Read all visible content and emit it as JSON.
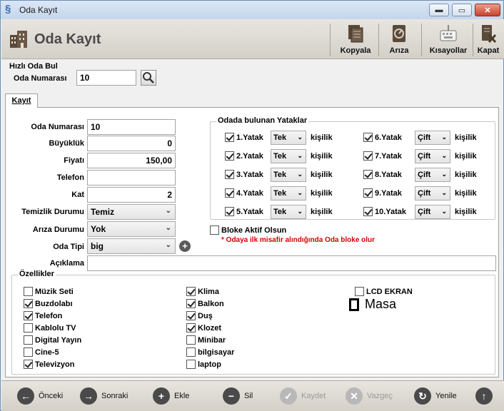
{
  "window": {
    "title": "Oda Kayıt",
    "minimize_icon": "minimize-icon",
    "maximize_icon": "maximize-icon",
    "close_icon": "close-icon"
  },
  "header": {
    "title": "Oda Kayıt",
    "tools": [
      {
        "label": "Kopyala",
        "icon": "copy-icon"
      },
      {
        "label": "Arıza",
        "icon": "fault-icon"
      },
      {
        "label": "Kısayollar",
        "icon": "keyboard-icon"
      },
      {
        "label": "Kapat",
        "icon": "close-doc-icon"
      }
    ]
  },
  "quick_search": {
    "title": "Hızlı Oda Bul",
    "label": "Oda Numarası",
    "value": "10"
  },
  "tab": {
    "label": "Kayıt"
  },
  "form": {
    "oda_numarasi": {
      "label": "Oda Numarası",
      "value": "10"
    },
    "buyukluk": {
      "label": "Büyüklük",
      "value": "0"
    },
    "fiyati": {
      "label": "Fiyatı",
      "value": "150,00"
    },
    "telefon": {
      "label": "Telefon",
      "value": ""
    },
    "kat": {
      "label": "Kat",
      "value": "2"
    },
    "temizlik": {
      "label": "Temizlik Durumu",
      "value": "Temiz"
    },
    "ariza": {
      "label": "Arıza Durumu",
      "value": "Yok"
    },
    "oda_tipi": {
      "label": "Oda Tipi",
      "value": "big"
    },
    "aciklama": {
      "label": "Açıklama",
      "value": ""
    }
  },
  "beds": {
    "title": "Odada bulunan Yataklar",
    "unit": "kişilik",
    "left": [
      {
        "label": "1.Yatak",
        "type": "Tek",
        "checked": true
      },
      {
        "label": "2.Yatak",
        "type": "Tek",
        "checked": true
      },
      {
        "label": "3.Yatak",
        "type": "Tek",
        "checked": true
      },
      {
        "label": "4.Yatak",
        "type": "Tek",
        "checked": true
      },
      {
        "label": "5.Yatak",
        "type": "Tek",
        "checked": true
      }
    ],
    "right": [
      {
        "label": "6.Yatak",
        "type": "Çift",
        "checked": true
      },
      {
        "label": "7.Yatak",
        "type": "Çift",
        "checked": true
      },
      {
        "label": "8.Yatak",
        "type": "Çift",
        "checked": true
      },
      {
        "label": "9.Yatak",
        "type": "Çift",
        "checked": true
      },
      {
        "label": "10.Yatak",
        "type": "Çift",
        "checked": true
      }
    ]
  },
  "block": {
    "label": "Bloke Aktif Olsun",
    "warning": "* Odaya ilk misafir alındığında Oda bloke olur"
  },
  "features": {
    "title": "Özellikler",
    "col1": [
      {
        "label": "Müzik Seti",
        "checked": false
      },
      {
        "label": "Buzdolabı",
        "checked": true
      },
      {
        "label": "Telefon",
        "checked": true
      },
      {
        "label": "Kablolu TV",
        "checked": false
      },
      {
        "label": "Digital Yayın",
        "checked": false
      },
      {
        "label": "Cine-5",
        "checked": false
      },
      {
        "label": "Televizyon",
        "checked": true
      }
    ],
    "col2": [
      {
        "label": "Klima",
        "checked": true
      },
      {
        "label": "Balkon",
        "checked": true
      },
      {
        "label": "Duş",
        "checked": true
      },
      {
        "label": "Klozet",
        "checked": true
      },
      {
        "label": "Minibar",
        "checked": false
      },
      {
        "label": "bilgisayar",
        "checked": false
      },
      {
        "label": "laptop",
        "checked": false
      }
    ],
    "col3": [
      {
        "label": "LCD EKRAN",
        "checked": false
      }
    ],
    "masa": {
      "label": "Masa"
    }
  },
  "footer": {
    "prev": "Önceki",
    "next": "Sonraki",
    "add": "Ekle",
    "delete": "Sil",
    "save": "Kaydet",
    "cancel": "Vazgeç",
    "refresh": "Yenile"
  }
}
